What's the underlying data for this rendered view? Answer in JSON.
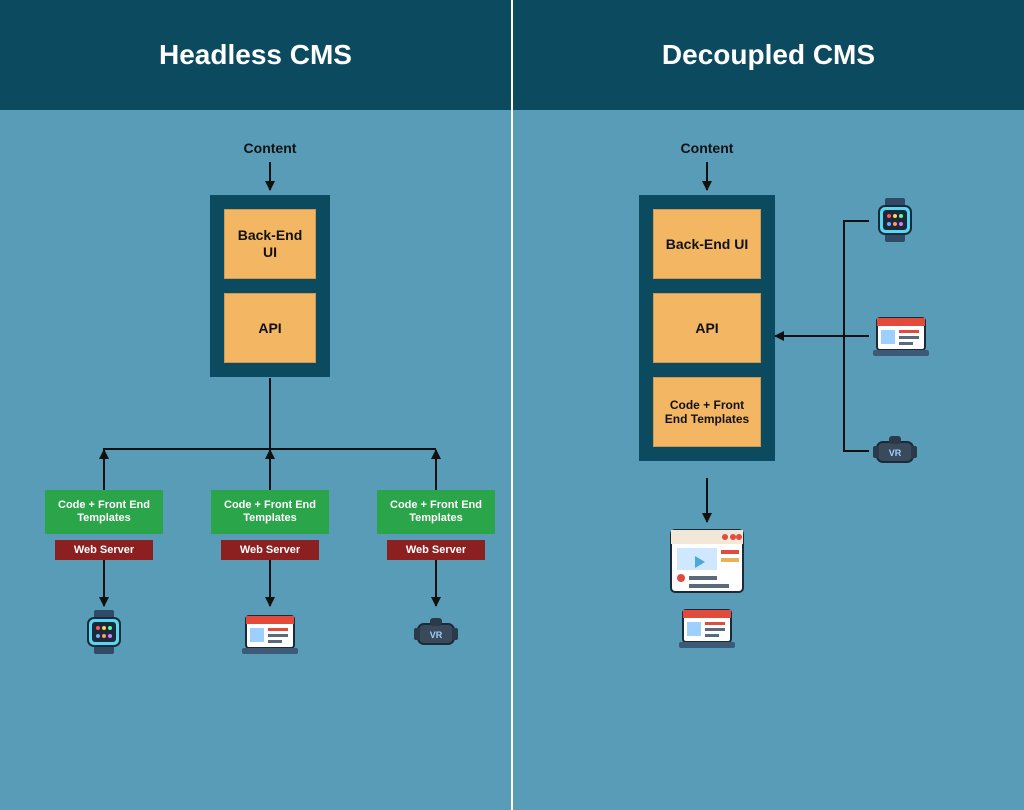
{
  "left": {
    "title": "Headless CMS",
    "content_label": "Content",
    "stack": {
      "backend": "Back-End UI",
      "api": "API"
    },
    "branches": [
      {
        "code": "Code + Front End Templates",
        "server": "Web Server",
        "device": "smartwatch"
      },
      {
        "code": "Code + Front End Templates",
        "server": "Web Server",
        "device": "laptop"
      },
      {
        "code": "Code + Front End Templates",
        "server": "Web Server",
        "device": "vr-headset"
      }
    ]
  },
  "right": {
    "title": "Decoupled CMS",
    "content_label": "Content",
    "stack": {
      "backend": "Back-End UI",
      "api": "API",
      "code": "Code + Front End Templates"
    },
    "outputs": [
      "browser",
      "laptop"
    ],
    "side_devices": [
      "smartwatch",
      "laptop",
      "vr-headset"
    ]
  }
}
